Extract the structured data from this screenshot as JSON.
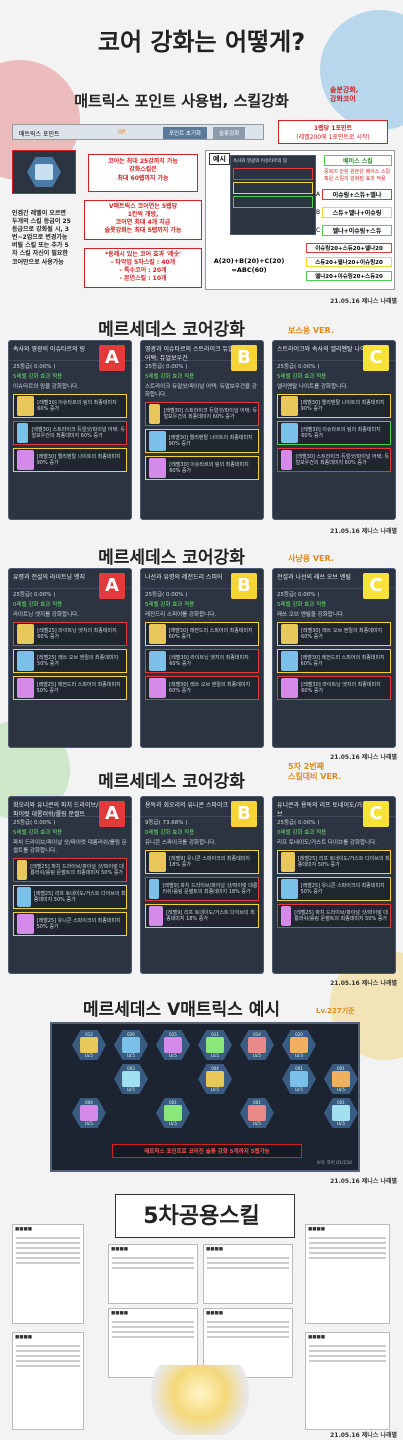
{
  "main_title": "코어 강화는 어떻게?",
  "credit": "21.05.16 제니스 나래별",
  "section1": {
    "title": "매트릭스 포인트 사용법, 스킬강화",
    "side_note_1": "솔분강화,",
    "side_note_2": "강화코어",
    "matrix_point_label": "매트릭스 포인트",
    "matrix_point_value": "0P",
    "reset_button": "포인트 초기화",
    "enhance_button": "슬롯강화",
    "point_rule_1": "1렙당 1포인트",
    "point_rule_2": "(레벨200에 1포인트로 시작)",
    "core_note_1": "코어는 최대 25강까지 가능",
    "core_note_2": "강화스킬은",
    "core_note_3": "최대 60렙까지 가능",
    "level_note": "인겜간 레벨이 오르면 두개의 스킬 등급이 25 등급으로 강화될 시, 3번~2업으로 변경가능 버릴 스킬 또는 추가 5차 스킬 자신이 필요한 코어만으로 사용가능",
    "v_note_1": "V매트릭스 코어연는 5렙당",
    "v_note_2": "1칸씩 개방,",
    "v_note_3": "코어연 최대 4개 지급",
    "v_note_4": "슬롯강화는 최대 5렙까지 가능",
    "bonus_1": "*동레시 있는 코어 효과 '레숫'",
    "bonus_2": "- 타악업 5차스킬 : 40개",
    "bonus_3": "- 특수코어 : 20개",
    "bonus_4": "- 본연스킬 : 10개",
    "example_label": "예시",
    "example_title": "속사와 영광의 이슈타르의 링",
    "base_skill": "베이스 스킬",
    "base_desc": "중복이 안된 원본은 베이스 스킬 혹은 스킬의 강화된 효과 적용",
    "row_A": "이슈링+스듀+엘나",
    "row_B": "스듀+엘나+이슈링",
    "row_C": "엘나+이슈링+스듀",
    "letter_A": "A",
    "letter_B": "B",
    "letter_C": "C",
    "formula": "A(20)+B(20)+C(20) =ABC(60)",
    "res_A": "이슈링20+스듀20+엘나20",
    "res_B": "스듀20+엘나20+이슈링20",
    "res_C": "엘나20+이슈링20+스듀20"
  },
  "section2": {
    "title": "메르세데스 코어강화",
    "tag": "보스용 VER.",
    "panels": [
      {
        "letter": "A",
        "title": "속사와 영광의 이슈타르의 링",
        "level": "25등급( 0.00% )",
        "effect": "5레벨 강화 효과 적용",
        "desc": "이슈타르의 링을 강화합니다.",
        "skills": [
          {
            "text": "[레벨30] 이슈타르의 링의 최종데미지 60% 증가",
            "color": "yel"
          },
          {
            "text": "[레벨30] 스트라이크 듀얼샷/파이널 어택: 듀얼보우건의 최종데미지 60% 증가",
            "color": "red"
          },
          {
            "text": "[레벨30] 엘리멘탈 나이트의 최종데미지 90% 증가",
            "color": "yel"
          }
        ]
      },
      {
        "letter": "B",
        "title": "영광과 이슈타르의 스트라이크 듀얼샷/파이널 어택: 듀얼보우건",
        "level": "25등급( 0.00% )",
        "effect": "5레벨 강화 효과 적용",
        "desc": "스트라이크 듀얼샷/파이널 어택: 듀얼보우건을 강화합니다.",
        "skills": [
          {
            "text": "[레벨30] 스트라이크 듀얼샷/파이널 어택: 듀얼보우건의 최종데미지 60% 증가",
            "color": "red"
          },
          {
            "text": "[레벨30] 엘리멘탈 나이트의 최종데미지 90% 증가",
            "color": "yel"
          },
          {
            "text": "[레벨30] 이슈타르의 링의 최종데미지 60% 증가",
            "color": "yel"
          }
        ]
      },
      {
        "letter": "C",
        "title": "스트라이크와 속사의 엘리멘탈 나이트",
        "level": "25등급( 0.00% )",
        "effect": "5레벨 강화 효과 적용",
        "desc": "엘리멘탈 나이트를 강화합니다.",
        "skills": [
          {
            "text": "[레벨30] 엘리멘탈 나이트의 최종데미지 90% 증가",
            "color": "yel"
          },
          {
            "text": "[레벨30] 이슈타르의 링의 최종데미지 60% 증가",
            "color": "grn"
          },
          {
            "text": "[레벨30] 스트라이크 듀얼샷/파이널 어택: 듀얼보우건의 최종데미지 60% 증가",
            "color": "red"
          }
        ]
      }
    ]
  },
  "section3": {
    "title": "메르세데스 코어강화",
    "tag": "사냥용 VER.",
    "panels": [
      {
        "letter": "A",
        "title": "유령과 전설의 라이트닝 엣지",
        "level": "25등급( 0.00% )",
        "effect": "0레벨 강화 효과 적용",
        "desc": "라이트닝 엣지를 강화합니다.",
        "skills": [
          {
            "text": "[레벨25] 라이트닝 엣지의 최종데미지 60% 증가",
            "color": "red"
          },
          {
            "text": "[레벨25] 래쓰 오브 엔릴의 최종데미지 50% 증가",
            "color": "yel"
          },
          {
            "text": "[레벨25] 레전드리 스피어의 최종데미지 50% 증가",
            "color": "yel"
          }
        ]
      },
      {
        "letter": "B",
        "title": "나선과 유령의 레전드리 스피어",
        "level": "25등급( 0.00% )",
        "effect": "5레벨 강화 효과 적용",
        "desc": "레전드리 스피어를 강화합니다.",
        "skills": [
          {
            "text": "[레벨30] 레전드리 스피어의 최종데미지 60% 증가",
            "color": "yel"
          },
          {
            "text": "[레벨30] 라이트닝 엣지의 최종데미지 60% 증가",
            "color": "red"
          },
          {
            "text": "[레벨30] 래쓰 오브 엔릴의 최종데미지 60% 증가",
            "color": "red"
          }
        ]
      },
      {
        "letter": "C",
        "title": "전설과 나선의 래쓰 오브 엔릴",
        "level": "25등급( 0.00% )",
        "effect": "5레벨 강화 효과 적용",
        "desc": "래쓰 오브 엔릴을 강화합니다.",
        "skills": [
          {
            "text": "[레벨30] 래쓰 오브 엔릴의 최종데미지 60% 증가",
            "color": "yel"
          },
          {
            "text": "[레벨30] 레전드리 스피어의 최종데미지 60% 증가",
            "color": "yel"
          },
          {
            "text": "[레벨30] 라이트닝 엣지의 최종데미지 60% 증가",
            "color": "red"
          }
        ]
      }
    ]
  },
  "section4": {
    "title": "메르세데스 코어강화",
    "tag_1": "5차 2번째",
    "tag_2": "스킬대비 VER.",
    "panels": [
      {
        "letter": "A",
        "title": "회오리와 유니콘의 파치 드라이브/파이널 샷/파이럿 대롱러쉬/롤링 문썰트",
        "level": "25등급( 0.00% )",
        "effect": "5레벨 강화 효과 적용",
        "desc": "파치 드라이브/파이널 샷/파이럿 대롱러쉬/롤링 문썰트를 강화합니다.",
        "skills": [
          {
            "text": "[레벨25] 파치 드라이브/파이널 샷/파이럿 대롱러쉬/롤링 문썰트의 최종데미지 50% 증가",
            "color": "red"
          },
          {
            "text": "[레벨25] 리프 토네이도/거스트 다이브의 최종데미지 50% 증가",
            "color": "yel"
          },
          {
            "text": "[레벨25] 유니콘 스파이크의 최종데미지 50% 증가",
            "color": "yel"
          }
        ]
      },
      {
        "letter": "B",
        "title": "용독과 회오리의 유니콘 스파이크",
        "level": "9등급( 73.68% )",
        "effect": "0레벨 강화 효과 적용",
        "desc": "유니콘 스파이크를 강화합니다.",
        "skills": [
          {
            "text": "[레벨9] 유니콘 스파이크의 최종데미지 18% 증가",
            "color": "yel"
          },
          {
            "text": "[레벨9] 파치 드라이브/파이널 샷/파이럿 대롱러쉬/롤링 문썰트의 최종데미지 18% 증가",
            "color": "red"
          },
          {
            "text": "[레벨9] 리프 토네이도/거스트 다이브의 최종데미지 18% 증가",
            "color": "yel"
          }
        ]
      },
      {
        "letter": "C",
        "title": "유니콘과 용독의 리프 토네이도/거스트 다이브",
        "level": "25등급( 0.00% )",
        "effect": "0레벨 강화 효과 적용",
        "desc": "리프 토네이도/거스트 다이브를 강화합니다.",
        "skills": [
          {
            "text": "[레벨25] 리프 토네이도/거스트 다이브의 최종데미지 50% 증가",
            "color": "yel"
          },
          {
            "text": "[레벨25] 유니콘 스파이크의 최종데미지 50% 증가",
            "color": "yel"
          },
          {
            "text": "[레벨25] 파치 드라이브/파이널 샷/파이럿 대롱러쉬/롤링 문썰트의 최종데미지 50% 증가",
            "color": "red"
          }
        ]
      }
    ]
  },
  "section5": {
    "title": "메르세데스 V매트릭스 예시",
    "tag": "Lv.227기준",
    "slot_labels": [
      "012",
      "026",
      "025",
      "011",
      "014",
      "020",
      "003",
      "004",
      "001",
      "004",
      "001",
      "001",
      "001",
      "001"
    ],
    "slot_levels": [
      "LV.5",
      "LV.5",
      "LV.5",
      "LV.5",
      "LV.5",
      "LV.3",
      "LV.5",
      "LV.5",
      "LV.5",
      "LV.5",
      "LV.5",
      "LV.5",
      "LV.5",
      "LV.5"
    ],
    "caption": "매트릭스 포인트로 코어진 슬롯 강화 5개까지 5렙가능",
    "footer": "보유 코어 01/150"
  },
  "section6": {
    "title": "5차공용스킬"
  },
  "colors": {
    "accent_red": "#d42020",
    "letter_yellow": "#f7d436",
    "panel_bg": "#2c3441"
  }
}
